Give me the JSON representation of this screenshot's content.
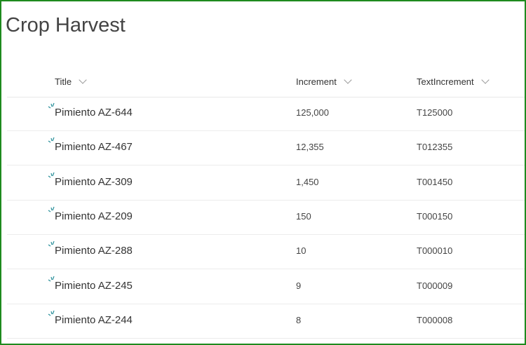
{
  "page": {
    "title": "Crop Harvest"
  },
  "columns": [
    "Title",
    "Increment",
    "TextIncrement"
  ],
  "rows": [
    {
      "title": "Pimiento AZ-644",
      "increment": "125,000",
      "text": "T125000"
    },
    {
      "title": "Pimiento AZ-467",
      "increment": "12,355",
      "text": "T012355"
    },
    {
      "title": "Pimiento AZ-309",
      "increment": "1,450",
      "text": "T001450"
    },
    {
      "title": "Pimiento AZ-209",
      "increment": "150",
      "text": "T000150"
    },
    {
      "title": "Pimiento AZ-288",
      "increment": "10",
      "text": "T000010"
    },
    {
      "title": "Pimiento AZ-245",
      "increment": "9",
      "text": "T000009"
    },
    {
      "title": "Pimiento AZ-244",
      "increment": "8",
      "text": "T000008"
    }
  ],
  "colors": {
    "border": "#1e8a1e",
    "new_icon": "#2a8f9a"
  }
}
